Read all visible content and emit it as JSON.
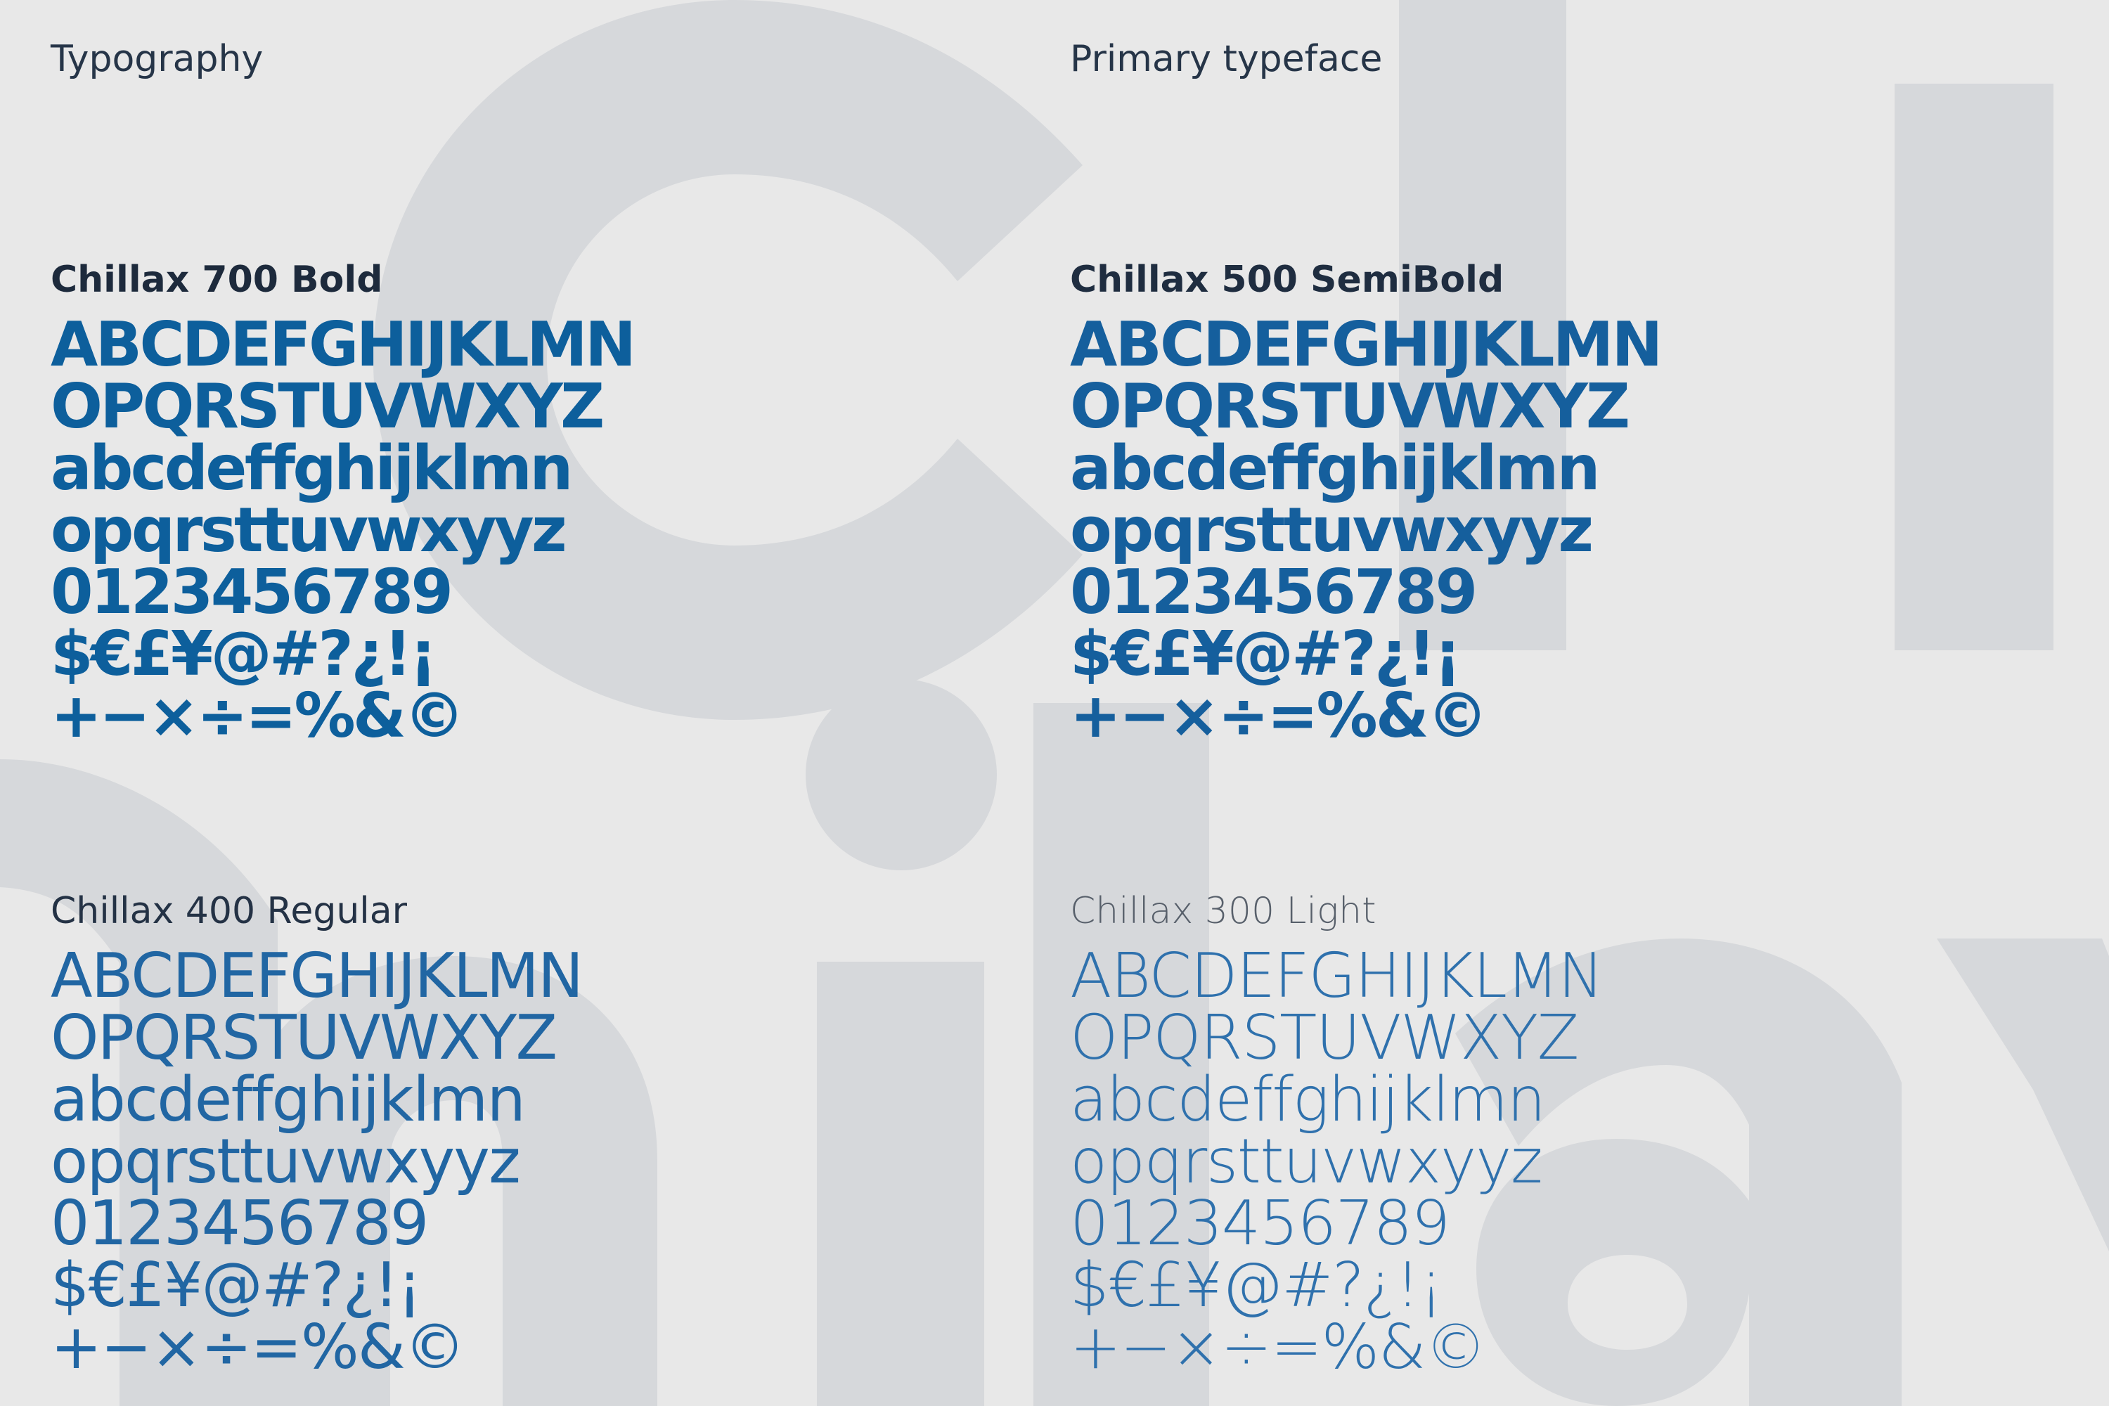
{
  "page": {
    "heading_left": "Typography",
    "heading_right": "Primary typeface"
  },
  "theme": {
    "background": "#e8e8e8",
    "shape": "#d6d8db",
    "title": "#1d2a3c",
    "glyph": "#0d5f9c"
  },
  "sections": [
    {
      "title": "Chillax 700 Bold",
      "lines": [
        "ABCDEFGHIJKLMN",
        "OPQRSTUVWXYZ",
        "abcdeffghijklmn",
        "opqrsttuvwxyyz",
        "0123456789",
        "$€£¥@#?¿!¡",
        "+−×÷=%&©"
      ]
    },
    {
      "title": "Chillax 500 SemiBold",
      "lines": [
        "ABCDEFGHIJKLMN",
        "OPQRSTUVWXYZ",
        "abcdeffghijklmn",
        "opqrsttuvwxyyz",
        "0123456789",
        "$€£¥@#?¿!¡",
        "+−×÷=%&©"
      ]
    },
    {
      "title": "Chillax 400 Regular",
      "lines": [
        "ABCDEFGHIJKLMN",
        "OPQRSTUVWXYZ",
        "abcdeffghijklmn",
        "opqrsttuvwxyyz",
        "0123456789",
        "$€£¥@#?¿!¡",
        "+−×÷=%&©"
      ]
    },
    {
      "title": "Chillax 300 Light",
      "lines": [
        "ABCDEFGHIJKLMN",
        "OPQRSTUVWXYZ",
        "abcdeffghijklmn",
        "opqrsttuvwxyyz",
        "0123456789",
        "$€£¥@#?¿!¡",
        "+−×÷=%&©"
      ]
    }
  ]
}
